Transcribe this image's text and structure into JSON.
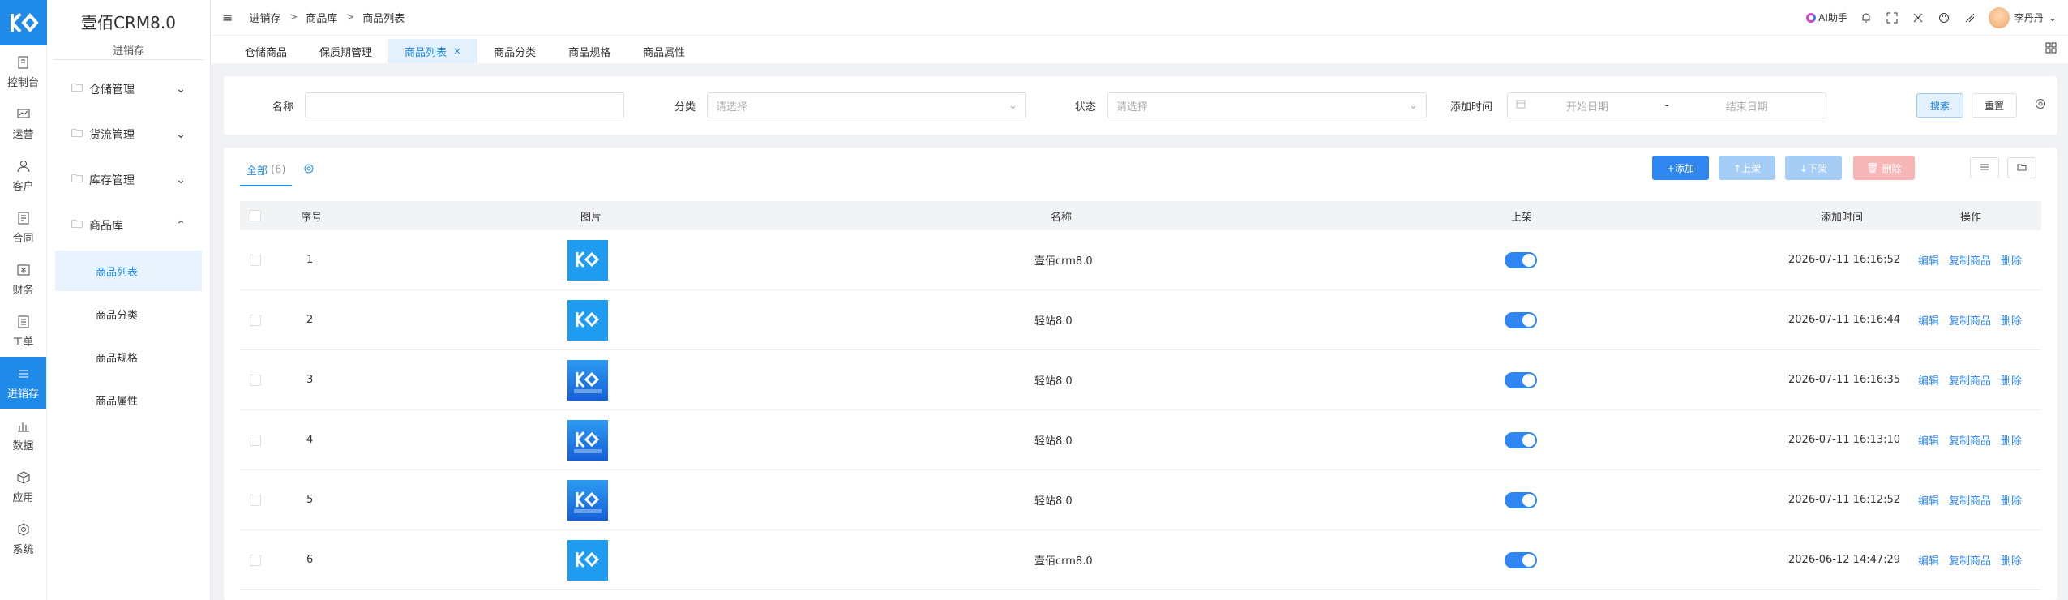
{
  "brand": {
    "title": "壹佰CRM8.0",
    "subtitle": "进销存"
  },
  "rail": [
    {
      "label": "控制台",
      "icon": "dashboard-icon"
    },
    {
      "label": "运营",
      "icon": "chart-line-icon"
    },
    {
      "label": "客户",
      "icon": "user-icon"
    },
    {
      "label": "合同",
      "icon": "contract-icon"
    },
    {
      "label": "财务",
      "icon": "finance-icon"
    },
    {
      "label": "工单",
      "icon": "ticket-icon"
    },
    {
      "label": "进销存",
      "icon": "list-icon",
      "active": true
    },
    {
      "label": "数据",
      "icon": "bar-chart-icon"
    },
    {
      "label": "应用",
      "icon": "cube-icon"
    },
    {
      "label": "系统",
      "icon": "gear-icon"
    }
  ],
  "sidebar": {
    "groups": [
      {
        "label": "仓储管理",
        "expanded": false
      },
      {
        "label": "货流管理",
        "expanded": false
      },
      {
        "label": "库存管理",
        "expanded": false
      },
      {
        "label": "商品库",
        "expanded": true
      }
    ],
    "leaves": [
      {
        "label": "商品列表",
        "active": true
      },
      {
        "label": "商品分类"
      },
      {
        "label": "商品规格"
      },
      {
        "label": "商品属性"
      }
    ]
  },
  "topbar": {
    "breadcrumb": [
      "进销存",
      "商品库",
      "商品列表"
    ],
    "ai_label": "AI助手",
    "user_name": "李丹丹"
  },
  "tabs": [
    {
      "label": "仓储商品"
    },
    {
      "label": "保质期管理"
    },
    {
      "label": "商品列表",
      "active": true
    },
    {
      "label": "商品分类"
    },
    {
      "label": "商品规格"
    },
    {
      "label": "商品属性"
    }
  ],
  "filter": {
    "name_label": "名称",
    "name_value": "",
    "category_label": "分类",
    "category_placeholder": "请选择",
    "status_label": "状态",
    "status_placeholder": "请选择",
    "time_label": "添加时间",
    "start_placeholder": "开始日期",
    "range_sep": "-",
    "end_placeholder": "结束日期",
    "search_label": "搜索",
    "reset_label": "重置"
  },
  "toolbar": {
    "tab_all": "全部",
    "tab_count": "(6)",
    "add_label": "+添加",
    "up_label": "↑上架",
    "down_label": "↓下架",
    "delete_label": "删除"
  },
  "table": {
    "columns": [
      "序号",
      "图片",
      "名称",
      "上架",
      "添加时间",
      "操作"
    ],
    "actions": [
      "编辑",
      "复制商品",
      "删除"
    ],
    "rows": [
      {
        "no": "1",
        "name": "壹佰crm8.0",
        "time": "2026-07-11 16:16:52",
        "on_shelf": true,
        "thumb": "plain"
      },
      {
        "no": "2",
        "name": "轻站8.0",
        "time": "2026-07-11 16:16:44",
        "on_shelf": true,
        "thumb": "plain"
      },
      {
        "no": "3",
        "name": "轻站8.0",
        "time": "2026-07-11 16:16:35",
        "on_shelf": true,
        "thumb": "labeled"
      },
      {
        "no": "4",
        "name": "轻站8.0",
        "time": "2026-07-11 16:13:10",
        "on_shelf": true,
        "thumb": "labeled"
      },
      {
        "no": "5",
        "name": "轻站8.0",
        "time": "2026-07-11 16:12:52",
        "on_shelf": true,
        "thumb": "labeled"
      },
      {
        "no": "6",
        "name": "壹佰crm8.0",
        "time": "2026-06-12 14:47:29",
        "on_shelf": true,
        "thumb": "plain"
      }
    ]
  },
  "colors": {
    "primary": "#1f8ae8",
    "link": "#2f86f0",
    "switch_on": "#2f86f0"
  }
}
